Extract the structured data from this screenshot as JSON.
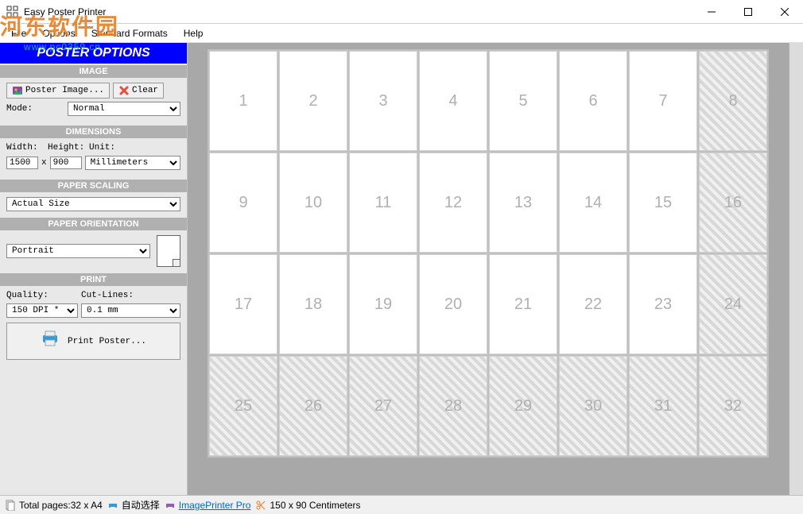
{
  "window": {
    "title": "Easy Poster Printer"
  },
  "menu": {
    "file": "File",
    "options": "Options",
    "standard_formats": "Standard Formats",
    "help": "Help"
  },
  "watermark": {
    "text": "河东软件园",
    "url": "www.pc0359.cn"
  },
  "sidebar": {
    "header": "POSTER OPTIONS",
    "image": {
      "title": "IMAGE",
      "poster_image_btn": "Poster Image...",
      "clear_btn": "Clear",
      "mode_label": "Mode:",
      "mode_value": "Normal"
    },
    "dimensions": {
      "title": "DIMENSIONS",
      "width_label": "Width:",
      "width_value": "1500",
      "x": "x",
      "height_label": "Height:",
      "height_value": "900",
      "unit_label": "Unit:",
      "unit_value": "Millimeters"
    },
    "paper_scaling": {
      "title": "PAPER SCALING",
      "value": "Actual Size"
    },
    "paper_orientation": {
      "title": "PAPER ORIENTATION",
      "value": "Portrait"
    },
    "print": {
      "title": "PRINT",
      "quality_label": "Quality:",
      "quality_value": "150 DPI *",
      "cutlines_label": "Cut-Lines:",
      "cutlines_value": "0.1 mm",
      "print_btn": "Print Poster..."
    }
  },
  "preview": {
    "cols": 8,
    "rows": 4,
    "pages": [
      {
        "n": "1",
        "partial": false
      },
      {
        "n": "2",
        "partial": false
      },
      {
        "n": "3",
        "partial": false
      },
      {
        "n": "4",
        "partial": false
      },
      {
        "n": "5",
        "partial": false
      },
      {
        "n": "6",
        "partial": false
      },
      {
        "n": "7",
        "partial": false
      },
      {
        "n": "8",
        "partial": true
      },
      {
        "n": "9",
        "partial": false
      },
      {
        "n": "10",
        "partial": false
      },
      {
        "n": "11",
        "partial": false
      },
      {
        "n": "12",
        "partial": false
      },
      {
        "n": "13",
        "partial": false
      },
      {
        "n": "14",
        "partial": false
      },
      {
        "n": "15",
        "partial": false
      },
      {
        "n": "16",
        "partial": true
      },
      {
        "n": "17",
        "partial": false
      },
      {
        "n": "18",
        "partial": false
      },
      {
        "n": "19",
        "partial": false
      },
      {
        "n": "20",
        "partial": false
      },
      {
        "n": "21",
        "partial": false
      },
      {
        "n": "22",
        "partial": false
      },
      {
        "n": "23",
        "partial": false
      },
      {
        "n": "24",
        "partial": true
      },
      {
        "n": "25",
        "partial": true
      },
      {
        "n": "26",
        "partial": true
      },
      {
        "n": "27",
        "partial": true
      },
      {
        "n": "28",
        "partial": true
      },
      {
        "n": "29",
        "partial": true
      },
      {
        "n": "30",
        "partial": true
      },
      {
        "n": "31",
        "partial": true
      },
      {
        "n": "32",
        "partial": true
      }
    ]
  },
  "statusbar": {
    "total_pages": "Total pages:32 x A4",
    "auto_select": "自动选择",
    "imageprinter": "ImagePrinter Pro",
    "size": "150 x 90 Centimeters"
  }
}
